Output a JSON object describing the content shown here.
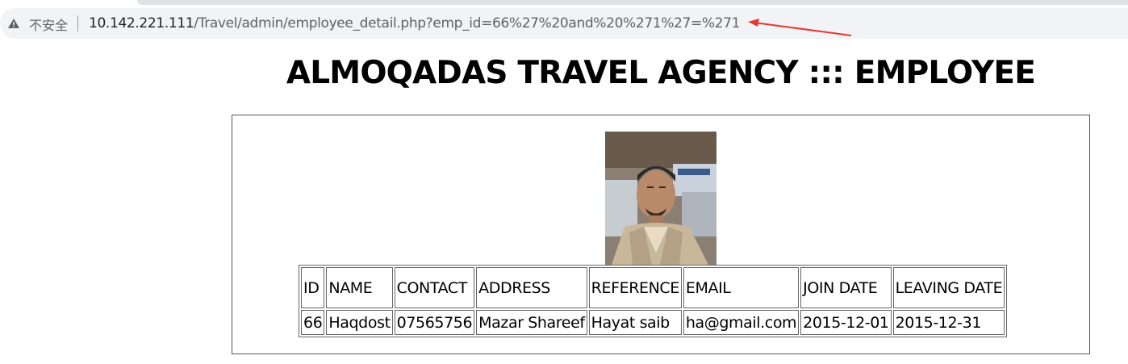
{
  "browser": {
    "security_label": "不安全",
    "url_host": "10.142.221.111",
    "url_path": "/Travel/admin/employee_detail.php?emp_id=66%27%20and%20%271%27=%271"
  },
  "page": {
    "title": "ALMOQADAS TRAVEL AGENCY ::: EMPLOYEE"
  },
  "employee_table": {
    "headers": [
      "ID",
      "NAME",
      "CONTACT",
      "ADDRESS",
      "REFERENCE",
      "EMAIL",
      "JOIN DATE",
      "LEAVING DATE"
    ],
    "row": [
      "66",
      "Haqdost",
      "07565756",
      "Mazar Shareef",
      "Hayat saib",
      "ha@gmail.com",
      "2015-12-01",
      "2015-12-31"
    ]
  },
  "colors": {
    "annotation_arrow": "#e53935",
    "address_bar_bg": "#f1f3f4"
  },
  "icons": {
    "security": "warning-triangle-icon"
  }
}
